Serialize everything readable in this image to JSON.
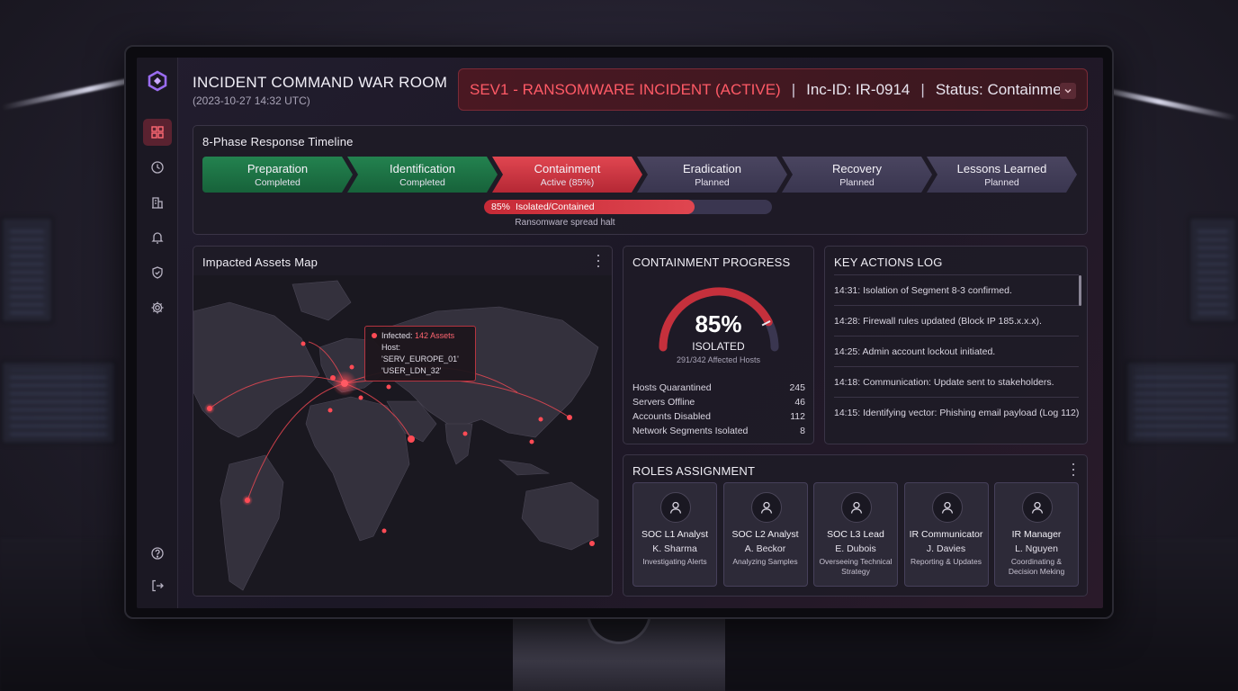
{
  "app": {
    "title": "INCIDENT COMMAND WAR ROOM",
    "timestamp": "(2023-10-27 14:32 UTC)"
  },
  "sidebar": {
    "items": [
      {
        "icon": "dashboard-grid-icon",
        "active": true
      },
      {
        "icon": "clock-icon",
        "active": false
      },
      {
        "icon": "server-icon",
        "active": false
      },
      {
        "icon": "bell-icon",
        "active": false
      },
      {
        "icon": "shield-check-icon",
        "active": false
      },
      {
        "icon": "gear-icon",
        "active": false
      }
    ],
    "bottom_items": [
      {
        "icon": "help-icon"
      },
      {
        "icon": "logout-icon"
      }
    ]
  },
  "incident": {
    "severity_label": "SEV1 - RANSOMWARE INCIDENT (ACTIVE)",
    "id_label": "Inc-ID: IR-0914",
    "status_label": "Status: Containment",
    "accent_color": "#ff5a66"
  },
  "timeline": {
    "title": "8-Phase Response Timeline",
    "phases": [
      {
        "name": "Preparation",
        "state": "Completed",
        "status": "done"
      },
      {
        "name": "Identification",
        "state": "Completed",
        "status": "done"
      },
      {
        "name": "Containment",
        "state": "Active (85%)",
        "status": "active"
      },
      {
        "name": "Eradication",
        "state": "Planned",
        "status": "planned"
      },
      {
        "name": "Recovery",
        "state": "Planned",
        "status": "planned"
      },
      {
        "name": "Lessons Learned",
        "state": "Planned",
        "status": "planned"
      }
    ],
    "progress": {
      "percent_label": "85%",
      "label": "Isolated/Contained",
      "fraction": 0.85,
      "note": "Ransomware spread halt"
    }
  },
  "map": {
    "title": "Impacted Assets Map",
    "tooltip": {
      "infected_label": "Infected:",
      "infected_value": "142 Assets",
      "host_line1": "Host: 'SERV_EUROPE_01'",
      "host_line2": "'USER_LDN_32'"
    }
  },
  "containment": {
    "title": "CONTAINMENT PROGRESS",
    "percent": "85%",
    "fraction": 0.85,
    "label": "ISOLATED",
    "sub": "291/342 Affected Hosts",
    "stats": [
      {
        "label": "Hosts Quarantined",
        "value": "245"
      },
      {
        "label": "Servers Offline",
        "value": "46"
      },
      {
        "label": "Accounts Disabled",
        "value": "112"
      },
      {
        "label": "Network Segments Isolated",
        "value": "8"
      }
    ]
  },
  "actions_log": {
    "title": "KEY ACTIONS LOG",
    "entries": [
      "14:31: Isolation of Segment 8-3 confirmed.",
      "14:28: Firewall rules updated (Block IP 185.x.x.x).",
      "14:25: Admin account lockout initiated.",
      "14:18: Communication: Update sent to stakeholders.",
      "14:15: Identifying vector: Phishing email payload (Log 112)"
    ]
  },
  "roles": {
    "title": "ROLES ASSIGNMENT",
    "items": [
      {
        "title": "SOC L1 Analyst",
        "name": "K. Sharma",
        "task": "Investigating Alerts"
      },
      {
        "title": "SOC L2 Analyst",
        "name": "A. Beckor",
        "task": "Analyzing Samples"
      },
      {
        "title": "SOC L3 Lead",
        "name": "E. Dubois",
        "task": "Overseeing Technical Strategy"
      },
      {
        "title": "IR Communicator",
        "name": "J. Davies",
        "task": "Reporting & Updates"
      },
      {
        "title": "IR Manager",
        "name": "L. Nguyen",
        "task": "Coordinating & Decision Meking"
      }
    ]
  }
}
